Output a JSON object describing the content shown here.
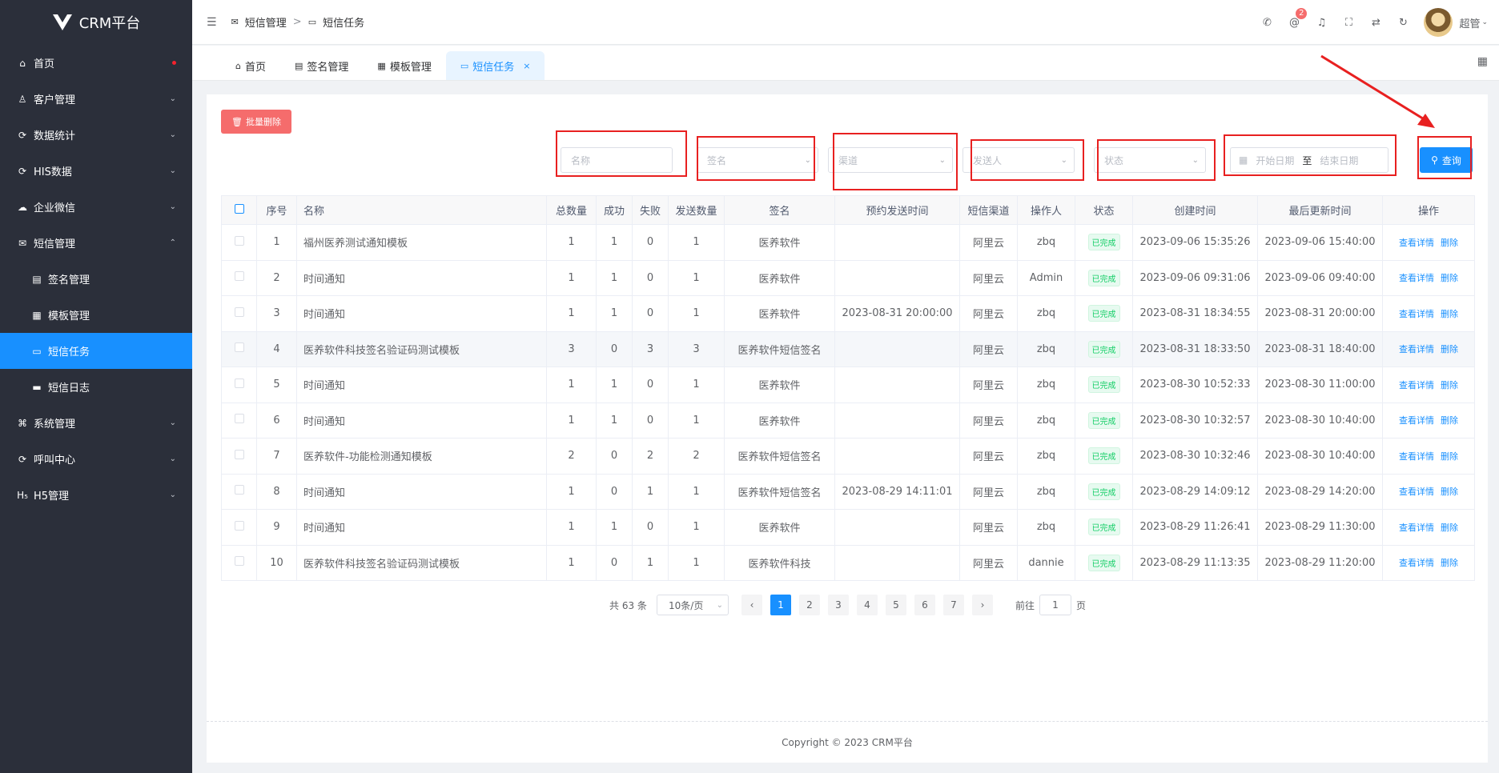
{
  "app": {
    "title": "CRM平台"
  },
  "sidebar": {
    "items": [
      {
        "label": "首页",
        "icon": "home-icon",
        "glyph": "⌂",
        "dot": true
      },
      {
        "label": "客户管理",
        "icon": "user-icon",
        "glyph": "♙",
        "chevron": "down"
      },
      {
        "label": "数据统计",
        "icon": "chart-icon",
        "glyph": "⟳",
        "chevron": "down"
      },
      {
        "label": "HIS数据",
        "icon": "sync-icon",
        "glyph": "⟳",
        "chevron": "down"
      },
      {
        "label": "企业微信",
        "icon": "wechat-icon",
        "glyph": "☁",
        "chevron": "down"
      },
      {
        "label": "短信管理",
        "icon": "message-icon",
        "glyph": "✉",
        "chevron": "up"
      },
      {
        "label": "签名管理",
        "icon": "doc-icon",
        "glyph": "▤",
        "sub": true
      },
      {
        "label": "模板管理",
        "icon": "template-icon",
        "glyph": "▦",
        "sub": true
      },
      {
        "label": "短信任务",
        "icon": "chat-icon",
        "glyph": "▭",
        "sub": true,
        "active": true
      },
      {
        "label": "短信日志",
        "icon": "log-icon",
        "glyph": "▬",
        "sub": true
      },
      {
        "label": "系统管理",
        "icon": "system-icon",
        "glyph": "⌘",
        "chevron": "down"
      },
      {
        "label": "呼叫中心",
        "icon": "phone-center-icon",
        "glyph": "⟳",
        "chevron": "down"
      },
      {
        "label": "H5管理",
        "icon": "h5-icon",
        "glyph": "H₅",
        "chevron": "down"
      }
    ]
  },
  "header": {
    "breadcrumb": [
      "短信管理",
      "短信任务"
    ],
    "notify_count": "2",
    "user": "超管"
  },
  "tabs": [
    {
      "label": "首页",
      "glyph": "⌂"
    },
    {
      "label": "签名管理",
      "glyph": "▤"
    },
    {
      "label": "模板管理",
      "glyph": "▦"
    },
    {
      "label": "短信任务",
      "glyph": "▭",
      "active": true
    }
  ],
  "toolbar": {
    "batch_delete": "批量删除",
    "search": "查询"
  },
  "filters": {
    "name": "名称",
    "signature": "签名",
    "channel": "渠道",
    "sender": "发送人",
    "status": "状态",
    "start_date": "开始日期",
    "date_sep": "至",
    "end_date": "结束日期"
  },
  "table": {
    "columns": [
      "序号",
      "名称",
      "总数量",
      "成功",
      "失败",
      "发送数量",
      "签名",
      "预约发送时间",
      "短信渠道",
      "操作人",
      "状态",
      "创建时间",
      "最后更新时间",
      "操作"
    ],
    "rows": [
      [
        "1",
        "福州医养测试通知模板",
        "1",
        "1",
        "0",
        "1",
        "医养软件",
        "",
        "阿里云",
        "zbq",
        "已完成",
        "2023-09-06 15:35:26",
        "2023-09-06 15:40:00"
      ],
      [
        "2",
        "时间通知",
        "1",
        "1",
        "0",
        "1",
        "医养软件",
        "",
        "阿里云",
        "Admin",
        "已完成",
        "2023-09-06 09:31:06",
        "2023-09-06 09:40:00"
      ],
      [
        "3",
        "时间通知",
        "1",
        "1",
        "0",
        "1",
        "医养软件",
        "2023-08-31 20:00:00",
        "阿里云",
        "zbq",
        "已完成",
        "2023-08-31 18:34:55",
        "2023-08-31 20:00:00"
      ],
      [
        "4",
        "医养软件科技签名验证码测试模板",
        "3",
        "0",
        "3",
        "3",
        "医养软件短信签名",
        "",
        "阿里云",
        "zbq",
        "已完成",
        "2023-08-31 18:33:50",
        "2023-08-31 18:40:00"
      ],
      [
        "5",
        "时间通知",
        "1",
        "1",
        "0",
        "1",
        "医养软件",
        "",
        "阿里云",
        "zbq",
        "已完成",
        "2023-08-30 10:52:33",
        "2023-08-30 11:00:00"
      ],
      [
        "6",
        "时间通知",
        "1",
        "1",
        "0",
        "1",
        "医养软件",
        "",
        "阿里云",
        "zbq",
        "已完成",
        "2023-08-30 10:32:57",
        "2023-08-30 10:40:00"
      ],
      [
        "7",
        "医养软件-功能检测通知模板",
        "2",
        "0",
        "2",
        "2",
        "医养软件短信签名",
        "",
        "阿里云",
        "zbq",
        "已完成",
        "2023-08-30 10:32:46",
        "2023-08-30 10:40:00"
      ],
      [
        "8",
        "时间通知",
        "1",
        "0",
        "1",
        "1",
        "医养软件短信签名",
        "2023-08-29 14:11:01",
        "阿里云",
        "zbq",
        "已完成",
        "2023-08-29 14:09:12",
        "2023-08-29 14:20:00"
      ],
      [
        "9",
        "时间通知",
        "1",
        "1",
        "0",
        "1",
        "医养软件",
        "",
        "阿里云",
        "zbq",
        "已完成",
        "2023-08-29 11:26:41",
        "2023-08-29 11:30:00"
      ],
      [
        "10",
        "医养软件科技签名验证码测试模板",
        "1",
        "0",
        "1",
        "1",
        "医养软件科技",
        "",
        "阿里云",
        "dannie",
        "已完成",
        "2023-08-29 11:13:35",
        "2023-08-29 11:20:00"
      ]
    ],
    "row_actions": {
      "detail": "查看详情",
      "delete": "删除"
    }
  },
  "pagination": {
    "total": "共 63 条",
    "page_size": "10条/页",
    "pages": [
      "1",
      "2",
      "3",
      "4",
      "5",
      "6",
      "7"
    ],
    "current": "1",
    "goto_label": "前往",
    "goto_value": "1",
    "page_suffix": "页"
  },
  "footer": {
    "copyright": "Copyright © 2023 CRM平台"
  },
  "colors": {
    "accent": "#1890ff",
    "danger": "#f56c6c",
    "sidebar": "#2b2f3a",
    "annotation": "#e82020"
  }
}
